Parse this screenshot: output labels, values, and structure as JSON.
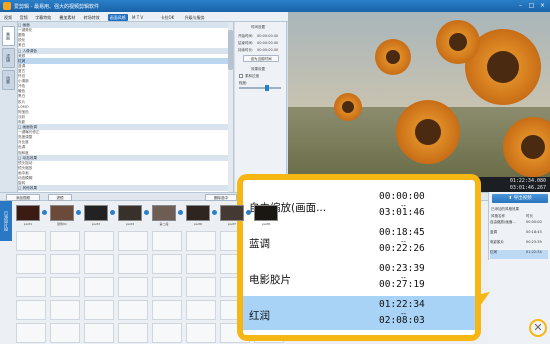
{
  "window": {
    "title": "爱剪辑",
    "subtitle": "最易用、强大的视频剪辑软件"
  },
  "menu": [
    "视频",
    "音频",
    "字幕特效",
    "叠加素材",
    "转场特效",
    "画面风格",
    "M T V",
    "卡拉OK",
    "升级与服务"
  ],
  "left_tabs": [
    "画面",
    "滤镜",
    "动景"
  ],
  "tree": [
    {
      "t": "□ 画面",
      "g": true
    },
    {
      "t": "    一键美化"
    },
    {
      "t": "    圆角"
    },
    {
      "t": "    锐化"
    },
    {
      "t": "    美白"
    },
    {
      "t": "□ 人像调色",
      "g": true
    },
    {
      "t": "    美颜"
    },
    {
      "t": "    红润",
      "s": true
    },
    {
      "t": "    蓝调"
    },
    {
      "t": "    复古"
    },
    {
      "t": "    怀旧"
    },
    {
      "t": "    小清新"
    },
    {
      "t": "    冷色"
    },
    {
      "t": "    暖色"
    },
    {
      "t": "    黑白"
    },
    {
      "t": "    胶片"
    },
    {
      "t": "    LOMO"
    },
    {
      "t": "    阿宝色"
    },
    {
      "t": "    淡彩"
    },
    {
      "t": "    电影"
    },
    {
      "t": "□ 画面色调",
      "g": true
    },
    {
      "t": "    一键曝光修正"
    },
    {
      "t": "    亮度调整"
    },
    {
      "t": "    对比度"
    },
    {
      "t": "    色调"
    },
    {
      "t": "    饱和度"
    },
    {
      "t": "□ 动态效果",
      "g": true
    },
    {
      "t": "    镜头摇动"
    },
    {
      "t": "    镜头缩放"
    },
    {
      "t": "    画中画"
    },
    {
      "t": "    动态模糊"
    },
    {
      "t": "    旋转"
    },
    {
      "t": "□ 其他效果",
      "g": true
    }
  ],
  "settings": {
    "title": "时间设置",
    "labels": [
      "开始时间:",
      "结束时间:",
      "持续时长:"
    ],
    "values": [
      "00:00:00.00",
      "00:00:00.00",
      "00:00:00.00"
    ],
    "btn1": "设为当前时间",
    "btn2": "效果设置",
    "chk": "柔和过渡",
    "degree": "程度:"
  },
  "player": {
    "time_current": "01:22:34.080",
    "time_total": "03:01:46.267"
  },
  "timeline": {
    "add_label": "添加视频",
    "tab2": "滤镜",
    "del_label": "删除选中",
    "side": "已添加片段",
    "clips": [
      "part1",
      "建筑01",
      "part3",
      "part4",
      "第二段",
      "part6",
      "part7",
      "part8"
    ]
  },
  "right_panel": {
    "export": "导出视频",
    "title": "已添加的风格效果",
    "col1": "风格名称",
    "col2": "时长",
    "rows": [
      {
        "n": "自由缩放(画面...",
        "t": "00:00:00"
      },
      {
        "n": "蓝调",
        "t": "00:18:45"
      },
      {
        "n": "电影胶片",
        "t": "00:23:39"
      },
      {
        "n": "红润",
        "t": "01:22:34"
      }
    ]
  },
  "callout": {
    "rows": [
      {
        "name": "自由缩放(画面...",
        "t1": "00:00:00",
        "t2": "03:01:46",
        "sel": false
      },
      {
        "name": "蓝调",
        "t1": "00:18:45",
        "t2": "00:22:26",
        "sel": false
      },
      {
        "name": "电影胶片",
        "t1": "00:23:39",
        "t2": "00:27:19",
        "sel": false
      },
      {
        "name": "红润",
        "t1": "01:22:34",
        "t2": "02:08:03",
        "sel": true
      }
    ]
  }
}
